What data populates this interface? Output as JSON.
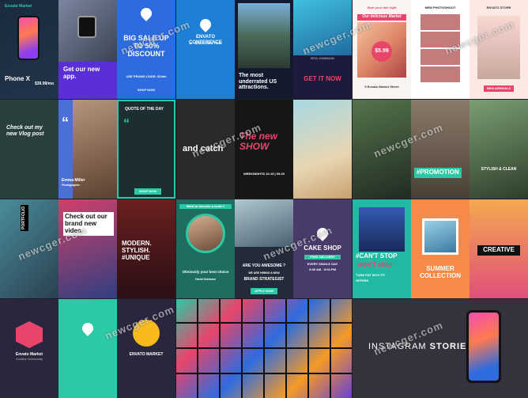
{
  "watermark": "newcger.com",
  "row1": {
    "c1": {
      "brand": "Envato Market",
      "phone_title": "Phone X",
      "phone_price": "$39.99/mo",
      "app_title": "Get our new app.",
      "sale_title": "BIG SALE UP TO 50% DISCOUNT",
      "promo": "USE PROMO CODE: 524dn",
      "shop_btn": "SHOP NOW"
    },
    "c2": {
      "conf_title": "ENVATO CONFERENCE",
      "conf_date": "26 - 28 MAY | NEW YORK",
      "us_title": "The most underrated US attractions.",
      "name": "RITA JOHNSON",
      "cta": "GET IT NOW"
    },
    "c3": {
      "head1": "Start your diet right",
      "market": "Our delicious Market",
      "price": "$5.99",
      "address": "9 Envato Market Street",
      "new_photos": "NEW PHOTOSHOOT",
      "env_store": "ENVATO STORE",
      "new_arrivals": "NEW ARRIVALS"
    }
  },
  "row2": {
    "c1": {
      "vlog": "Check out my new Vlog post",
      "name": "Emma Miller",
      "role": "Photographer",
      "qod": "QUOTE OF THE DAY",
      "shop": "SHOP NOW"
    },
    "c2": {
      "catch": "and catch",
      "show": "The new SHOW",
      "weeknights": "WEEKNIGHTS 10:15 | 09:20"
    },
    "c3": {
      "promo": "#PROMOTION",
      "stylish": "STYLISH & CLEAN"
    }
  },
  "row3": {
    "c1": {
      "portfolio": "PORTFOLIO",
      "brand_video": "Check out our brand new video.",
      "modern": "MODERN. STYLISH. #UNIQUE"
    },
    "c2": {
      "coder": "Want to become a coder?",
      "best": "Obviously your best choice",
      "david": "David Goldman",
      "awesome": "ARE YOU AWESOME ?",
      "hiring": "WE ARE HIRING A NEW",
      "strategist": "BRAND STRATEGIST",
      "apply": "APPLY NOW",
      "cake": "CAKE SHOP",
      "delivery": "FREE DELIVERY",
      "every": "EVERY SINGLE DAY",
      "hours": "9:00 AM - 5:00 PM"
    },
    "c3": {
      "cant": "#CAN'T STOP",
      "wont": "won't stop",
      "turn": "TURN PAT INTO FIT",
      "offers": "OFFERS",
      "summer": "SUMMER COLLECTION",
      "creative": "CREATIVE"
    }
  },
  "row4": {
    "c1": {
      "envato": "Envato Market",
      "envato_sub": "Creative Community",
      "envato2": "ENVATO MARKET"
    },
    "c3": {
      "stories_a": "INSTAGRAM ",
      "stories_b": "STORIES"
    }
  },
  "colors": {
    "bg": "#1d1d26",
    "teal": "#2bc9a5",
    "pink": "#e8456b",
    "orange": "#f59a27",
    "yellow": "#f7b91c",
    "blue": "#2d6be0",
    "purple": "#6a3fd1"
  }
}
